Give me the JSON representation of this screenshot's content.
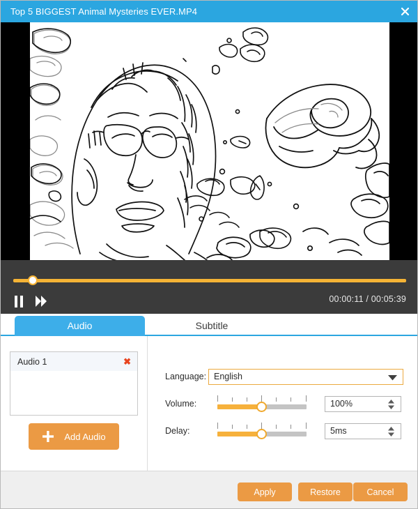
{
  "window": {
    "title": "Top 5 BIGGEST Animal Mysteries EVER.MP4",
    "close_icon": "close-icon",
    "titlebar_color": "#2ba6e0"
  },
  "player": {
    "pause_icon": "pause-icon",
    "forward_icon": "fast-forward-icon",
    "current_time": "00:00:11",
    "total_time": "00:05:39",
    "time_display": "00:00:11 / 00:05:39",
    "progress_percent": 4,
    "accent_color": "#f5b335",
    "background_color": "#3b3b3b"
  },
  "tabs": [
    {
      "label": "Audio",
      "active": true
    },
    {
      "label": "Subtitle",
      "active": false
    }
  ],
  "audio_panel": {
    "tracks": [
      {
        "name": "Audio 1",
        "delete_icon": "close-icon",
        "selected": true
      }
    ],
    "add_button": {
      "label": "Add Audio",
      "icon": "plus-icon",
      "color": "#eb9a44"
    },
    "fields": {
      "language": {
        "label": "Language:",
        "value": "English",
        "arrow_icon": "chevron-down-icon",
        "border_color": "#eba93f"
      },
      "volume": {
        "label": "Volume:",
        "value": "100%",
        "slider_percent": 50,
        "tick_count": 7
      },
      "delay": {
        "label": "Delay:",
        "value": "5ms",
        "slider_percent": 50,
        "tick_count": 7
      }
    }
  },
  "footer": {
    "apply_label": "Apply",
    "restore_label": "Restore",
    "cancel_label": "Cancel",
    "button_color": "#eb9a44"
  }
}
